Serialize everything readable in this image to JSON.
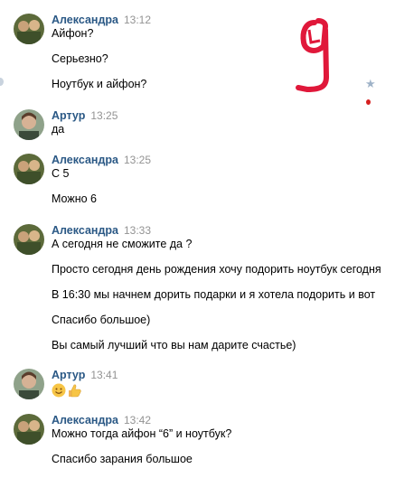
{
  "colors": {
    "name": "#2a5885",
    "time": "#939393",
    "annotation": "#e0183a"
  },
  "annotation": {
    "text": "9"
  },
  "messages": [
    {
      "author": "Александра",
      "time": "13:12",
      "avatar": "avatar-alexandra",
      "lines": [
        "Айфон?",
        "Серьезно?",
        "Ноутбук и айфон?"
      ]
    },
    {
      "author": "Артур",
      "time": "13:25",
      "avatar": "avatar-artur",
      "lines": [
        "да"
      ]
    },
    {
      "author": "Александра",
      "time": "13:25",
      "avatar": "avatar-alexandra",
      "lines": [
        "С 5",
        "Можно 6"
      ]
    },
    {
      "author": "Александра",
      "time": "13:33",
      "avatar": "avatar-alexandra",
      "lines": [
        "А сегодня не сможите да ?",
        "Просто сегодня день рождения хочу подорить ноутбук сегодня",
        "В 16:30 мы начнем дорить подарки и я хотела подорить и вот",
        "Спасибо большое)",
        "Вы самый лучший что вы нам дарите счастье)"
      ]
    },
    {
      "author": "Артур",
      "time": "13:41",
      "avatar": "avatar-artur",
      "lines": [],
      "emoji": [
        "smile-emoji-icon",
        "thumbs-up-emoji-icon"
      ]
    },
    {
      "author": "Александра",
      "time": "13:42",
      "avatar": "avatar-alexandra",
      "lines": [
        "Можно тогда айфон “6” и ноутбук?",
        "Спасибо зарания большое"
      ]
    }
  ]
}
